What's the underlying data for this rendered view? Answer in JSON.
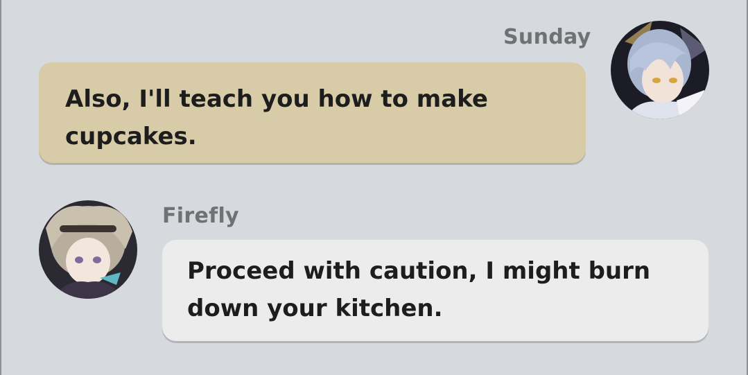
{
  "messages": [
    {
      "sender": "Sunday",
      "side": "right",
      "text_line1": "Also, I'll teach you how to make",
      "text_line2": "cupcakes.",
      "bubble_color": "#d8cca8"
    },
    {
      "sender": "Firefly",
      "side": "left",
      "text_line1": "Proceed with caution, I might burn",
      "text_line2": "down your kitchen.",
      "bubble_color": "#ececed"
    }
  ],
  "colors": {
    "background": "#d6d9de",
    "name_text": "#6f7173",
    "message_text": "#1d1d1d"
  },
  "icons": {
    "sunday_avatar": "sunday-avatar-portrait",
    "firefly_avatar": "firefly-avatar-portrait"
  }
}
